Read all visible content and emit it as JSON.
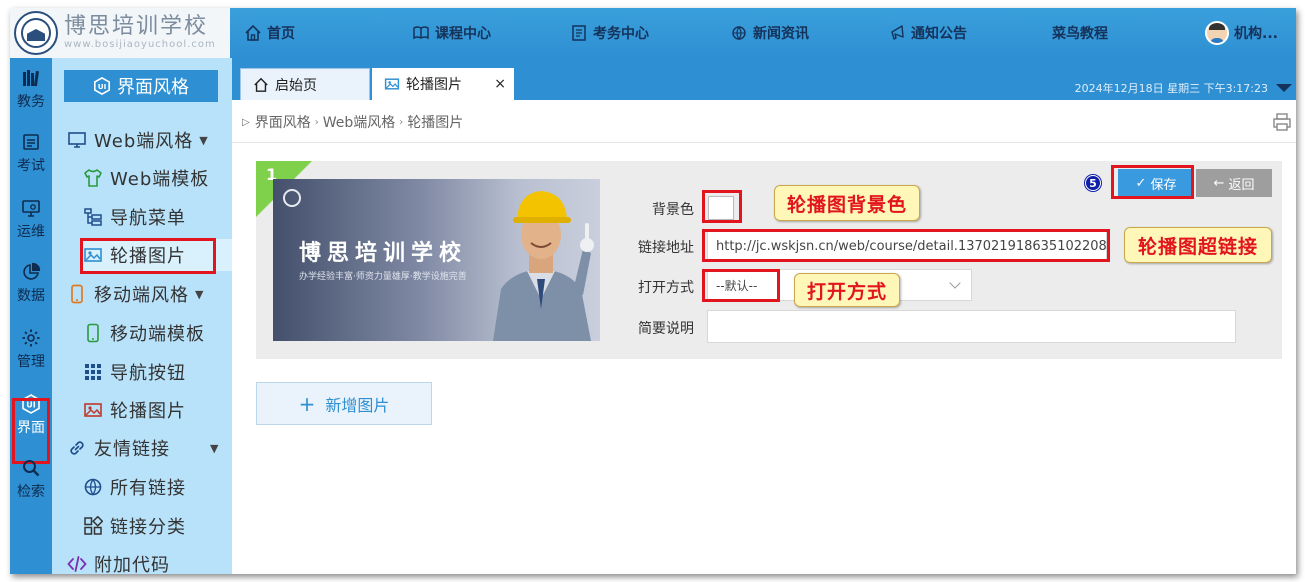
{
  "logo": {
    "name": "博思培训学校",
    "url": "www.bosijiaoyuchool.com"
  },
  "nav": [
    {
      "label": "首页",
      "icon": "home-icon"
    },
    {
      "label": "课程中心",
      "icon": "book-icon"
    },
    {
      "label": "考务中心",
      "icon": "exam-icon"
    },
    {
      "label": "新闻资讯",
      "icon": "news-icon"
    },
    {
      "label": "通知公告",
      "icon": "megaphone-icon"
    },
    {
      "label": "菜鸟教程",
      "icon": ""
    },
    {
      "label": "机构...",
      "icon": "avatar"
    }
  ],
  "rail": [
    {
      "label": "教务",
      "icon": "books-icon"
    },
    {
      "label": "考试",
      "icon": "exam-icon"
    },
    {
      "label": "运维",
      "icon": "monitor-gear-icon"
    },
    {
      "label": "数据",
      "icon": "pie-chart-icon"
    },
    {
      "label": "管理",
      "icon": "gear-icon"
    },
    {
      "label": "界面",
      "icon": "ui-icon"
    },
    {
      "label": "检索",
      "icon": "search-icon"
    }
  ],
  "menu": {
    "header": "界面风格",
    "items": [
      {
        "label": "Web端风格",
        "icon": "monitor-icon"
      },
      {
        "label": "Web端模板",
        "icon": "shirt-icon"
      },
      {
        "label": "导航菜单",
        "icon": "tree-menu-icon"
      },
      {
        "label": "轮播图片",
        "icon": "image-icon"
      },
      {
        "label": "移动端风格",
        "icon": "phone-icon"
      },
      {
        "label": "移动端模板",
        "icon": "phone-outline-icon"
      },
      {
        "label": "导航按钮",
        "icon": "grid-icon"
      },
      {
        "label": "轮播图片",
        "icon": "image-icon"
      },
      {
        "label": "友情链接",
        "icon": "link-icon"
      },
      {
        "label": "所有链接",
        "icon": "globe-icon"
      },
      {
        "label": "链接分类",
        "icon": "category-icon"
      },
      {
        "label": "附加代码",
        "icon": "code-icon"
      }
    ]
  },
  "tabs": {
    "home": "启始页",
    "active": "轮播图片",
    "close": "×",
    "datetime": "2024年12月18日 星期三 下午3:17:23"
  },
  "breadcrumb": [
    "界面风格",
    "Web端风格",
    "轮播图片"
  ],
  "panel": {
    "index": "1",
    "banner_title": "博思培训学校",
    "banner_sub": "办学经验丰富·师资力量雄厚·教学设施完善",
    "labels": {
      "bg_color": "背景色",
      "link": "链接地址",
      "open_mode": "打开方式",
      "desc": "简要说明"
    },
    "link_value": "http://jc.wskjsn.cn/web/course/detail.1370219186351022​08",
    "open_mode_value": "--默认--",
    "desc_value": "",
    "save": "保存",
    "back": "返回",
    "step": "5"
  },
  "callouts": {
    "bg_color": "轮播图背景色",
    "link": "轮播图超链接",
    "open_mode": "打开方式"
  },
  "add_button": "新增图片",
  "colors": {
    "accent": "#2e8fd2",
    "menu_bg": "#b8e2fa",
    "highlight": "#e2141d",
    "callout_bg": "#fff7b8"
  }
}
